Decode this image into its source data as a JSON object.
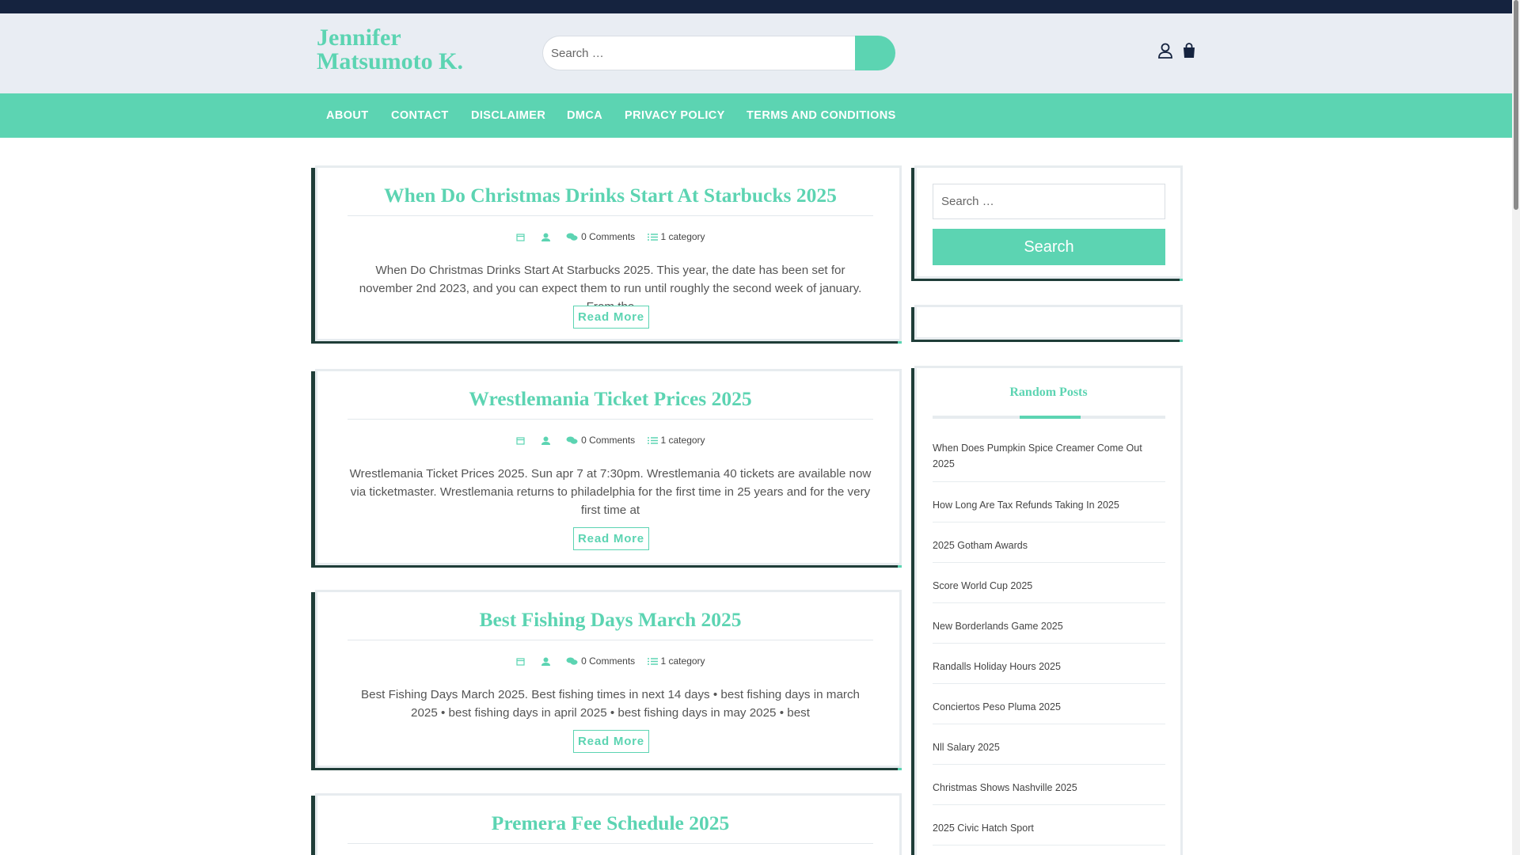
{
  "site": {
    "title": "Jennifer Matsumoto K."
  },
  "header_search": {
    "placeholder": "Search …"
  },
  "nav": [
    {
      "label": "ABOUT"
    },
    {
      "label": "CONTACT"
    },
    {
      "label": "DISCLAIMER"
    },
    {
      "label": "DMCA"
    },
    {
      "label": "PRIVACY POLICY"
    },
    {
      "label": "TERMS AND CONDITIONS"
    }
  ],
  "posts": [
    {
      "title": "When Do Christmas Drinks Start At Starbucks 2025",
      "comments": "0 Comments",
      "category": "1 category",
      "excerpt": "When Do Christmas Drinks Start At Starbucks 2025. This year, the date has been set for november 2nd 2023, and you can expect them to run until roughly the second week of january. From the",
      "read_more": "Read More"
    },
    {
      "title": "Wrestlemania Ticket Prices 2025",
      "comments": "0 Comments",
      "category": "1 category",
      "excerpt": "Wrestlemania Ticket Prices 2025. Sun apr 7 at 7:30pm. Wrestlemania 40 tickets are available now via ticketmaster. Wrestlemania returns to philadelphia for the first time in 25 years and for the very first time at",
      "read_more": "Read More"
    },
    {
      "title": "Best Fishing Days March 2025",
      "comments": "0 Comments",
      "category": "1 category",
      "excerpt": "Best Fishing Days March 2025. Best fishing times in next 14 days • best fishing days in march 2025 • best fishing days in april 2025 • best fishing days in may 2025 • best",
      "read_more": "Read More"
    },
    {
      "title": "Premera Fee Schedule 2025"
    }
  ],
  "sidebar": {
    "search_placeholder": "Search …",
    "search_button": "Search",
    "random_posts_title": "Random Posts",
    "random_posts": [
      "When Does Pumpkin Spice Creamer Come Out 2025",
      "How Long Are Tax Refunds Taking In 2025",
      "2025 Gotham Awards",
      "Score World Cup 2025",
      "New Borderlands Game 2025",
      "Randalls Holiday Hours 2025",
      "Conciertos Peso Pluma 2025",
      "Nll Salary 2025",
      "Christmas Shows Nashville 2025",
      "2025 Civic Hatch Sport"
    ]
  },
  "icons": {
    "header_search": "search-icon",
    "account": "user-icon",
    "cart": "shopping-bag-icon",
    "date": "calendar-icon",
    "author": "author-icon",
    "comments": "comments-icon",
    "category": "list-icon"
  },
  "colors": {
    "accent": "#5cd4b2",
    "topbar": "#15233f",
    "header_bg": "#e9edf3"
  }
}
